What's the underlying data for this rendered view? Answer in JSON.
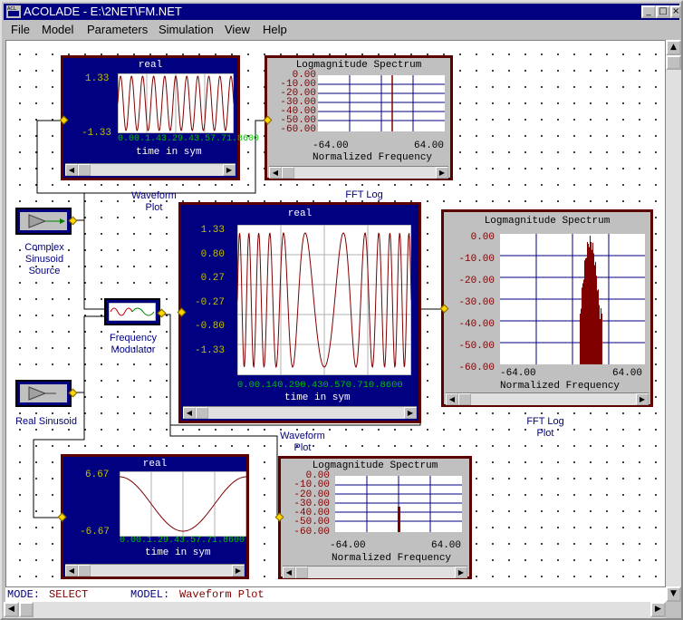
{
  "window": {
    "title": "ACOLADE - E:\\2NET\\FM.NET",
    "buttons": [
      "_",
      "□",
      "×"
    ]
  },
  "menu": [
    "File",
    "Model",
    "Parameters",
    "Simulation",
    "View",
    "Help"
  ],
  "status": {
    "mode_label": "MODE:",
    "mode_value": "SELECT",
    "model_label": "MODEL:",
    "model_value": "Waveform Plot"
  },
  "sources": {
    "complex": {
      "caption": [
        "Complex",
        "Sinusoid",
        "Source"
      ]
    },
    "fm": {
      "caption": [
        "Frequency",
        "Modulator"
      ]
    },
    "real": {
      "caption": [
        "Real Sinusoid"
      ]
    }
  },
  "plots": {
    "wave_small": {
      "title": "real",
      "yticks": [
        "1.33",
        "-1.33"
      ],
      "xticks": "0.00.1.43.29.43.57.71.8600",
      "xlabel": "time in sym",
      "caption": [
        "Waveform",
        "Plot"
      ]
    },
    "fft_small": {
      "title": "Logmagnitude Spectrum",
      "yticks": [
        "0.00",
        "-10.00",
        "-20.00",
        "-30.00",
        "-40.00",
        "-50.00",
        "-60.00"
      ],
      "xticks": [
        "-64.00",
        "64.00"
      ],
      "xlabel": "Normalized Frequency",
      "caption": [
        "FFT Log"
      ]
    },
    "wave_big": {
      "title": "real",
      "yticks": [
        "1.33",
        "0.80",
        "0.27",
        "-0.27",
        "-0.80",
        "-1.33"
      ],
      "xticks": "0.00.140.290.430.570.710.8600",
      "xlabel": "time in sym",
      "caption": [
        "Waveform",
        "Plot"
      ]
    },
    "fft_big": {
      "title": "Logmagnitude Spectrum",
      "yticks": [
        "0.00",
        "-10.00",
        "-20.00",
        "-30.00",
        "-40.00",
        "-50.00",
        "-60.00"
      ],
      "xticks": [
        "-64.00",
        "64.00"
      ],
      "xlabel": "Normalized Frequency",
      "caption": [
        "FFT Log",
        "Plot"
      ]
    },
    "wave_bottom": {
      "title": "real",
      "yticks": [
        "6.67",
        "-6.67"
      ],
      "xticks": "0.00.1.29.43.57.71.8600",
      "xlabel": "time in sym"
    },
    "fft_bottom": {
      "title": "Logmagnitude Spectrum",
      "yticks": [
        "0.00",
        "-10.00",
        "-20.00",
        "-30.00",
        "-40.00",
        "-50.00",
        "-60.00"
      ],
      "xticks": [
        "-64.00",
        "64.00"
      ],
      "xlabel": "Normalized Frequency"
    }
  },
  "colors": {
    "titlebar": "#000080",
    "plot_bg": "#000080",
    "trace": "#800000",
    "frame": "#5a0000",
    "port": "#ffd700"
  },
  "icons": [
    "app-icon",
    "triangle-source-icon",
    "fm-wave-icon",
    "scroll-arrow-icons"
  ]
}
